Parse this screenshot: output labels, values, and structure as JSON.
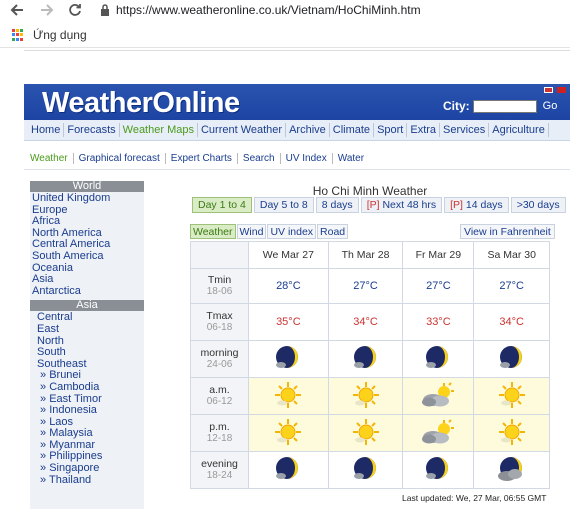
{
  "browser": {
    "url_prefix": "https://",
    "url_host": "www.weatheronline.co.uk",
    "url_path": "/Vietnam/HoChiMinh.htm",
    "bookmarks_apps_label": "Ứng dụng",
    "icons": [
      "back-arrow-icon",
      "forward-arrow-icon",
      "reload-icon",
      "lock-icon",
      "apps-grid-icon"
    ]
  },
  "site": {
    "logo": "WeatherOnline",
    "city_label": "City:",
    "city_go": "Go",
    "main_nav": [
      "Home",
      "Forecasts",
      "Weather Maps",
      "Current Weather",
      "Archive",
      "Climate",
      "Sport",
      "Extra",
      "Services",
      "Agriculture"
    ],
    "main_nav_active": "Weather Maps",
    "sub_nav": [
      "Weather",
      "Graphical forecast",
      "Expert Charts",
      "Search",
      "UV Index",
      "Water"
    ],
    "colors": {
      "header_blue": "#1d44a3",
      "link_blue": "#1a3d8f",
      "active_green": "#4a9a1c",
      "tmax_red": "#cc3333"
    }
  },
  "sidebar": {
    "world_title": "World",
    "world_links": [
      "United Kingdom",
      "Europe",
      "Africa",
      "North America",
      "Central America",
      "South America",
      "Oceania",
      "Asia",
      "Antarctica"
    ],
    "asia_title": "Asia",
    "asia_regions": [
      "Central",
      "East",
      "North",
      "South",
      "Southeast"
    ],
    "asia_countries": [
      "Brunei",
      "Cambodia",
      "East Timor",
      "Indonesia",
      "Laos",
      "Malaysia",
      "Myanmar",
      "Philippines",
      "Singapore",
      "Thailand"
    ]
  },
  "forecast": {
    "title": "Ho Chi Minh Weather",
    "day_tabs": [
      {
        "label": "Day 1 to 4",
        "active": true,
        "prefix": ""
      },
      {
        "label": "Day 5 to 8",
        "active": false,
        "prefix": ""
      },
      {
        "label": "8 days",
        "active": false,
        "prefix": ""
      },
      {
        "label": " Next 48 hrs",
        "active": false,
        "prefix": "[P]"
      },
      {
        "label": " 14 days",
        "active": false,
        "prefix": "[P]"
      },
      {
        "label": ">30 days",
        "active": false,
        "prefix": ""
      }
    ],
    "view_tabs": [
      "Weather",
      "Wind",
      "UV index",
      "Road"
    ],
    "fahrenheit_link": "View in Fahrenheit",
    "days": [
      "We Mar 27",
      "Th Mar 28",
      "Fr Mar 29",
      "Sa Mar 30"
    ],
    "tmin": {
      "label": "Tmin",
      "range": "18-06",
      "values": [
        "28°C",
        "27°C",
        "27°C",
        "27°C"
      ]
    },
    "tmax": {
      "label": "Tmax",
      "range": "06-18",
      "values": [
        "35°C",
        "34°C",
        "33°C",
        "34°C"
      ]
    },
    "periods": [
      {
        "label": "morning",
        "range": "24-06",
        "icons": [
          "moon-partly-cloudy-icon",
          "moon-partly-cloudy-icon",
          "moon-partly-cloudy-icon",
          "moon-partly-cloudy-icon"
        ]
      },
      {
        "label": "a.m.",
        "range": "06-12",
        "icons": [
          "sun-icon",
          "sun-icon",
          "cloud-sun-icon",
          "sun-icon"
        ]
      },
      {
        "label": "p.m.",
        "range": "12-18",
        "icons": [
          "sun-icon",
          "sun-icon",
          "cloud-sun-icon",
          "sun-icon"
        ]
      },
      {
        "label": "evening",
        "range": "18-24",
        "icons": [
          "moon-partly-cloudy-icon",
          "moon-partly-cloudy-icon",
          "moon-partly-cloudy-icon",
          "moon-cloudy-icon"
        ]
      }
    ],
    "updated": "Last updated: We, 27 Mar, 06:55 GMT"
  }
}
